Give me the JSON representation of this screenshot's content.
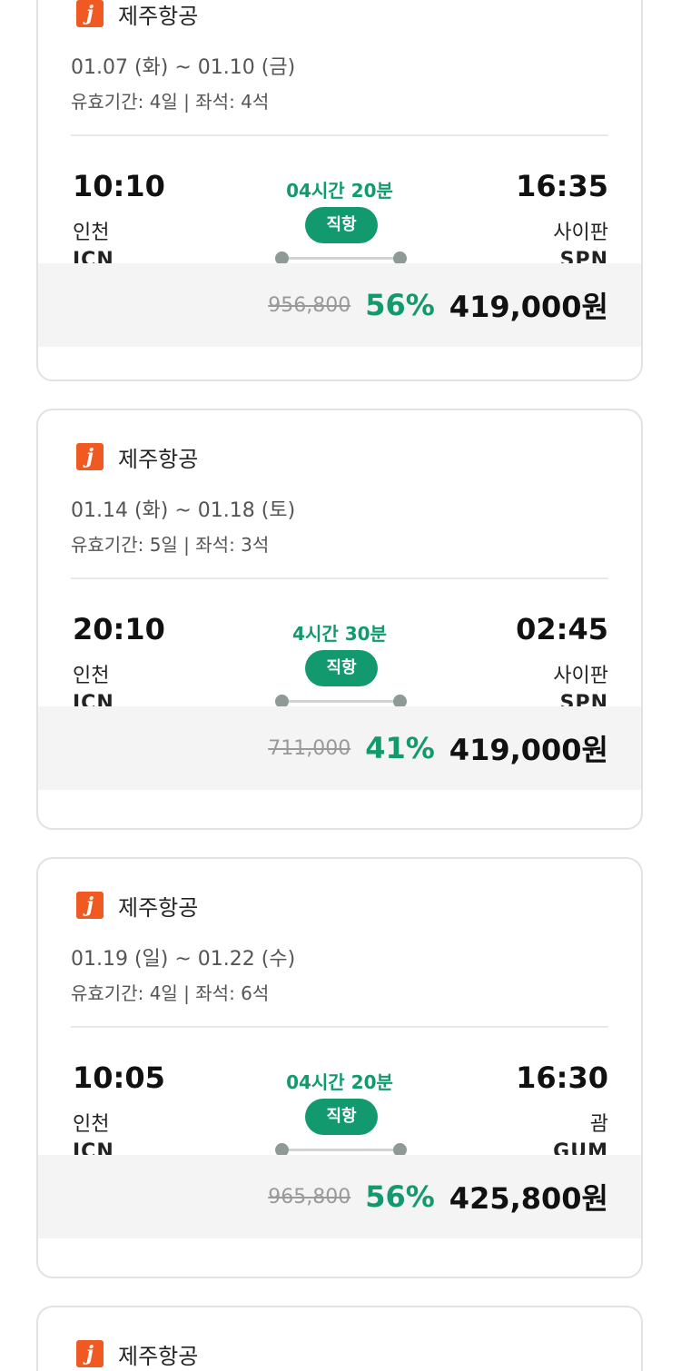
{
  "colors": {
    "accent": "#129a6e",
    "logo": "#f05a22",
    "price_bar": "#f4f4f4"
  },
  "logo_icon": "jeju-air-logo",
  "cards": [
    {
      "airline": "제주항공",
      "dates": "01.07 (화) ~ 01.10 (금)",
      "meta": "유효기간: 4일 | 좌석: 4석",
      "dep": {
        "time": "10:10",
        "city": "인천",
        "code": "ICN"
      },
      "arr": {
        "time": "16:35",
        "city": "사이판",
        "code": "SPN"
      },
      "duration": "04시간 20분",
      "badge": "직항",
      "original_price": "956,800",
      "discount": "56%",
      "final_price": "419,000원"
    },
    {
      "airline": "제주항공",
      "dates": "01.14 (화) ~ 01.18 (토)",
      "meta": "유효기간: 5일 | 좌석: 3석",
      "dep": {
        "time": "20:10",
        "city": "인천",
        "code": "ICN"
      },
      "arr": {
        "time": "02:45",
        "city": "사이판",
        "code": "SPN"
      },
      "duration": "4시간 30분",
      "badge": "직항",
      "original_price": "711,000",
      "discount": "41%",
      "final_price": "419,000원"
    },
    {
      "airline": "제주항공",
      "dates": "01.19 (일) ~ 01.22 (수)",
      "meta": "유효기간: 4일 | 좌석: 6석",
      "dep": {
        "time": "10:05",
        "city": "인천",
        "code": "ICN"
      },
      "arr": {
        "time": "16:30",
        "city": "괌",
        "code": "GUM"
      },
      "duration": "04시간 20분",
      "badge": "직항",
      "original_price": "965,800",
      "discount": "56%",
      "final_price": "425,800원"
    },
    {
      "airline": "제주항공"
    }
  ]
}
